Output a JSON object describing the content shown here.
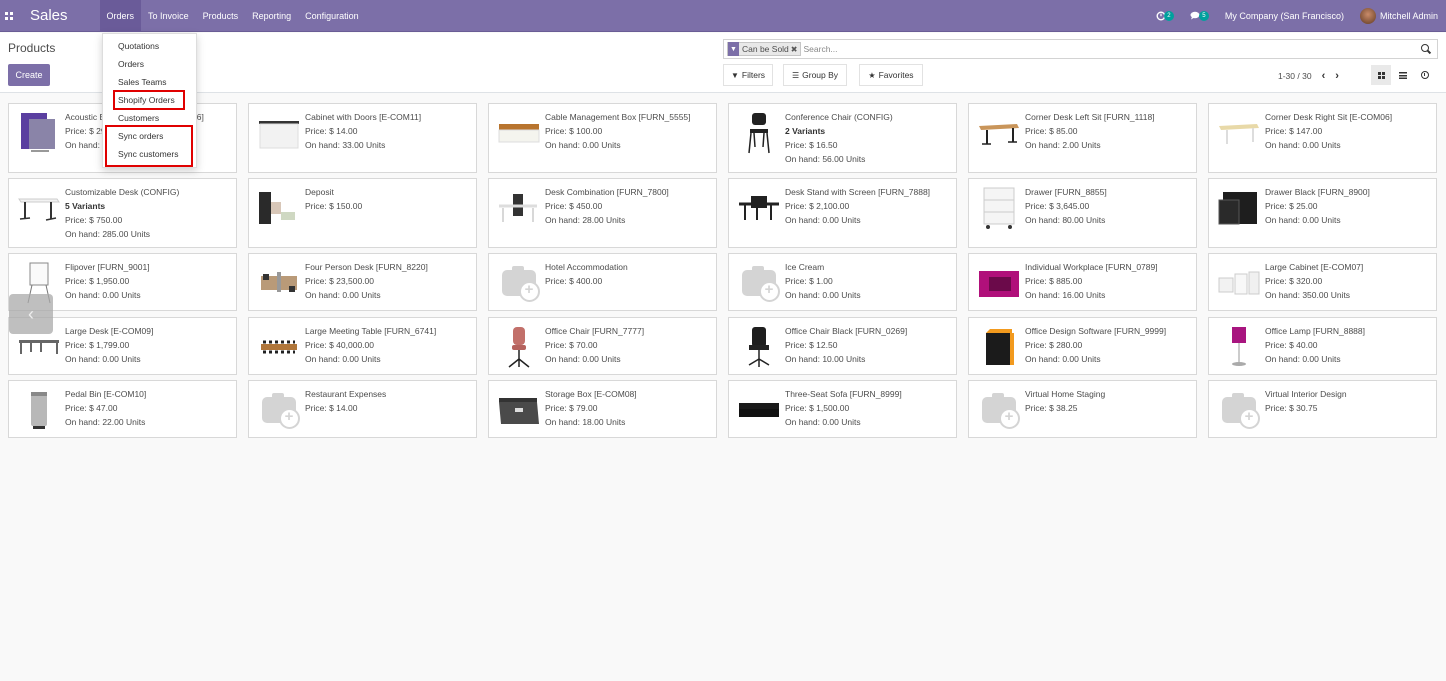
{
  "navbar": {
    "app_title": "Sales",
    "menu": [
      {
        "label": "Orders",
        "active": true
      },
      {
        "label": "To Invoice"
      },
      {
        "label": "Products"
      },
      {
        "label": "Reporting"
      },
      {
        "label": "Configuration"
      }
    ],
    "activity_count": "2",
    "messages_count": "5",
    "company": "My Company (San Francisco)",
    "user": "Mitchell Admin"
  },
  "orders_dropdown": {
    "items": [
      "Quotations",
      "Orders",
      "Sales Teams",
      "Shopify Orders",
      "Customers",
      "Sync orders",
      "Sync customers"
    ],
    "highlighted": [
      "Shopify Orders",
      "Sync orders",
      "Sync customers"
    ],
    "highlight_color": "#e00000"
  },
  "control_panel": {
    "breadcrumb": "Products",
    "create_label": "Create",
    "facet_label": "Can be Sold",
    "search_placeholder": "Search...",
    "filters_label": "Filters",
    "group_by_label": "Group By",
    "favorites_label": "Favorites",
    "pager": "1-30 / 30",
    "views": [
      "kanban",
      "list",
      "activity"
    ],
    "active_view": "kanban"
  },
  "colors": {
    "brand": "#7c6fa8",
    "badge": "#00a09d"
  },
  "products": [
    {
      "name": "Acoustic Bloc Screens [FURN_6666]",
      "variants": null,
      "price": "Price: $ 295.00",
      "onhand": "On hand: 0.00 Units",
      "image": "acoustic-screen"
    },
    {
      "name": "Cabinet with Doors [E-COM11]",
      "variants": null,
      "price": "Price: $ 14.00",
      "onhand": "On hand: 33.00 Units",
      "image": "cabinet"
    },
    {
      "name": "Cable Management Box [FURN_5555]",
      "variants": null,
      "price": "Price: $ 100.00",
      "onhand": "On hand: 0.00 Units",
      "image": "cable-box"
    },
    {
      "name": "Conference Chair (CONFIG)",
      "variants": "2 Variants",
      "price": "Price: $ 16.50",
      "onhand": "On hand: 56.00 Units",
      "image": "chair"
    },
    {
      "name": "Corner Desk Left Sit [FURN_1118]",
      "variants": null,
      "price": "Price: $ 85.00",
      "onhand": "On hand: 2.00 Units",
      "image": "desk-wood"
    },
    {
      "name": "Corner Desk Right Sit [E-COM06]",
      "variants": null,
      "price": "Price: $ 147.00",
      "onhand": "On hand: 0.00 Units",
      "image": "desk-light"
    },
    {
      "name": "Customizable Desk (CONFIG)",
      "variants": "5 Variants",
      "price": "Price: $ 750.00",
      "onhand": "On hand: 285.00 Units",
      "image": "desk-white"
    },
    {
      "name": "Deposit",
      "variants": null,
      "price": "Price: $ 150.00",
      "onhand": null,
      "image": "deposit"
    },
    {
      "name": "Desk Combination [FURN_7800]",
      "variants": null,
      "price": "Price: $ 450.00",
      "onhand": "On hand: 28.00 Units",
      "image": "desk-combo"
    },
    {
      "name": "Desk Stand with Screen [FURN_7888]",
      "variants": null,
      "price": "Price: $ 2,100.00",
      "onhand": "On hand: 0.00 Units",
      "image": "desk-stand"
    },
    {
      "name": "Drawer [FURN_8855]",
      "variants": null,
      "price": "Price: $ 3,645.00",
      "onhand": "On hand: 80.00 Units",
      "image": "drawer-white"
    },
    {
      "name": "Drawer Black [FURN_8900]",
      "variants": null,
      "price": "Price: $ 25.00",
      "onhand": "On hand: 0.00 Units",
      "image": "drawer-black"
    },
    {
      "name": "Flipover [FURN_9001]",
      "variants": null,
      "price": "Price: $ 1,950.00",
      "onhand": "On hand: 0.00 Units",
      "image": "flipover"
    },
    {
      "name": "Four Person Desk [FURN_8220]",
      "variants": null,
      "price": "Price: $ 23,500.00",
      "onhand": "On hand: 0.00 Units",
      "image": "four-desk"
    },
    {
      "name": "Hotel Accommodation",
      "variants": null,
      "price": "Price: $ 400.00",
      "onhand": null,
      "image": "placeholder"
    },
    {
      "name": "Ice Cream",
      "variants": null,
      "price": "Price: $ 1.00",
      "onhand": "On hand: 0.00 Units",
      "image": "placeholder"
    },
    {
      "name": "Individual Workplace [FURN_0789]",
      "variants": null,
      "price": "Price: $ 885.00",
      "onhand": "On hand: 16.00 Units",
      "image": "workplace"
    },
    {
      "name": "Large Cabinet [E-COM07]",
      "variants": null,
      "price": "Price: $ 320.00",
      "onhand": "On hand: 350.00 Units",
      "image": "large-cabinet"
    },
    {
      "name": "Large Desk [E-COM09]",
      "variants": null,
      "price": "Price: $ 1,799.00",
      "onhand": "On hand: 0.00 Units",
      "image": "large-desk"
    },
    {
      "name": "Large Meeting Table [FURN_6741]",
      "variants": null,
      "price": "Price: $ 40,000.00",
      "onhand": "On hand: 0.00 Units",
      "image": "meeting-table"
    },
    {
      "name": "Office Chair [FURN_7777]",
      "variants": null,
      "price": "Price: $ 70.00",
      "onhand": "On hand: 0.00 Units",
      "image": "chair-pink"
    },
    {
      "name": "Office Chair Black [FURN_0269]",
      "variants": null,
      "price": "Price: $ 12.50",
      "onhand": "On hand: 10.00 Units",
      "image": "chair-black"
    },
    {
      "name": "Office Design Software [FURN_9999]",
      "variants": null,
      "price": "Price: $ 280.00",
      "onhand": "On hand: 0.00 Units",
      "image": "software"
    },
    {
      "name": "Office Lamp [FURN_8888]",
      "variants": null,
      "price": "Price: $ 40.00",
      "onhand": "On hand: 0.00 Units",
      "image": "lamp"
    },
    {
      "name": "Pedal Bin [E-COM10]",
      "variants": null,
      "price": "Price: $ 47.00",
      "onhand": "On hand: 22.00 Units",
      "image": "bin"
    },
    {
      "name": "Restaurant Expenses",
      "variants": null,
      "price": "Price: $ 14.00",
      "onhand": null,
      "image": "placeholder"
    },
    {
      "name": "Storage Box [E-COM08]",
      "variants": null,
      "price": "Price: $ 79.00",
      "onhand": "On hand: 18.00 Units",
      "image": "storage-box"
    },
    {
      "name": "Three-Seat Sofa [FURN_8999]",
      "variants": null,
      "price": "Price: $ 1,500.00",
      "onhand": "On hand: 0.00 Units",
      "image": "sofa"
    },
    {
      "name": "Virtual Home Staging",
      "variants": null,
      "price": "Price: $ 38.25",
      "onhand": null,
      "image": "placeholder"
    },
    {
      "name": "Virtual Interior Design",
      "variants": null,
      "price": "Price: $ 30.75",
      "onhand": null,
      "image": "placeholder"
    }
  ]
}
